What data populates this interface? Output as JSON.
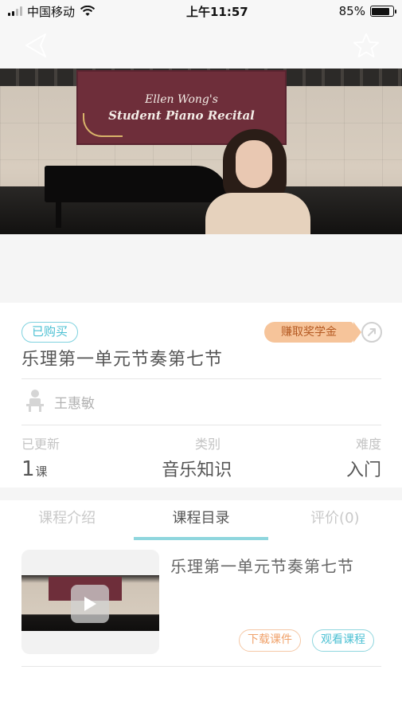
{
  "status_bar": {
    "carrier": "中国移动",
    "time": "上午11:57",
    "battery_percent": "85%",
    "battery_level": 0.85
  },
  "nav": {
    "back_icon": "back-triangle-icon",
    "favorite_icon": "star-outline-icon"
  },
  "hero": {
    "banner_line1": "Ellen Wong's",
    "banner_line2": "Student Piano Recital"
  },
  "course": {
    "purchased_tag": "已购买",
    "scholarship_label": "赚取奖学金",
    "title": "乐理第一单元节奏第七节",
    "teacher": "王惠敏",
    "stats": {
      "updated_label": "已更新",
      "updated_count": "1",
      "updated_unit": "课",
      "category_label": "类别",
      "category_value": "音乐知识",
      "difficulty_label": "难度",
      "difficulty_value": "入门"
    }
  },
  "tabs": [
    {
      "label": "课程介绍",
      "active": false
    },
    {
      "label": "课程目录",
      "active": true
    },
    {
      "label": "评价(0)",
      "active": false
    }
  ],
  "lessons": [
    {
      "title": "乐理第一单元节奏第七节",
      "download_label": "下载课件",
      "watch_label": "观看课程"
    }
  ],
  "colors": {
    "accent": "#4cc0d3",
    "scholarship_bg": "#f6c49a",
    "download_border": "#f5c8a6"
  }
}
